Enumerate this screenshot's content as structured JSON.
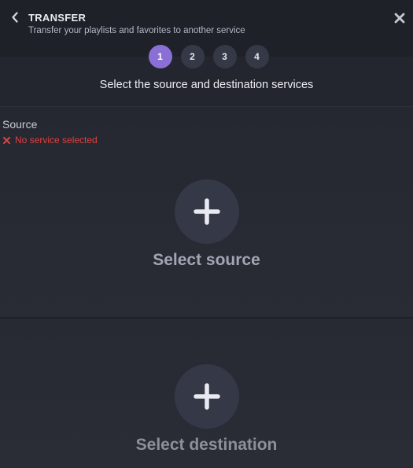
{
  "header": {
    "title": "TRANSFER",
    "subtitle": "Transfer your playlists and favorites to another service",
    "back_icon": "chevron-left-icon",
    "close_icon": "close-icon"
  },
  "steps": [
    {
      "label": "1",
      "active": true
    },
    {
      "label": "2",
      "active": false
    },
    {
      "label": "3",
      "active": false
    },
    {
      "label": "4",
      "active": false
    }
  ],
  "instruction": "Select the source and destination services",
  "source": {
    "label": "Source",
    "status_text": "No service selected",
    "select_label": "Select source"
  },
  "destination": {
    "select_label": "Select destination"
  },
  "colors": {
    "accent": "#8a6fd4",
    "error": "#e0413f",
    "background": "#24262f",
    "circle": "#353846"
  }
}
